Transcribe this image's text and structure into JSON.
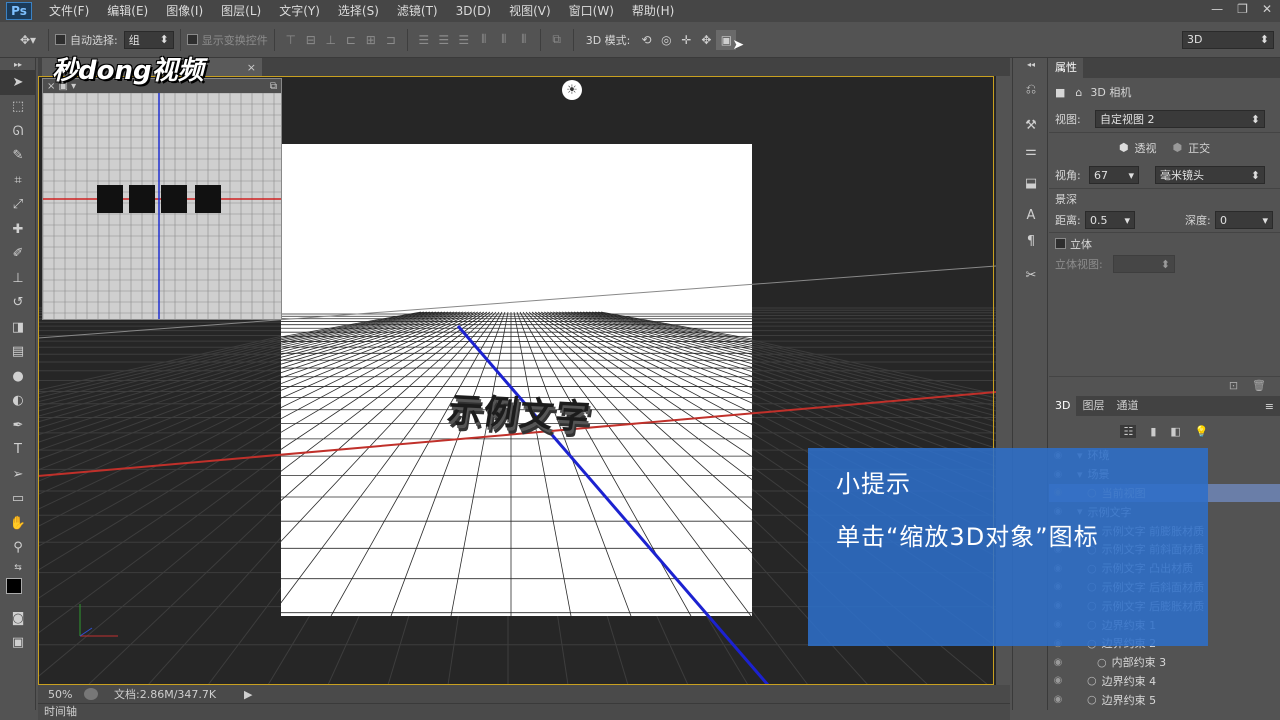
{
  "app": {
    "logo": "Ps"
  },
  "menu": [
    "文件(F)",
    "编辑(E)",
    "图像(I)",
    "图层(L)",
    "文字(Y)",
    "选择(S)",
    "滤镜(T)",
    "3D(D)",
    "视图(V)",
    "窗口(W)",
    "帮助(H)"
  ],
  "window_controls": [
    "—",
    "❐",
    "✕"
  ],
  "options": {
    "auto_select_label": "自动选择:",
    "auto_select_value": "组",
    "show_transform_label": "显示变换控件",
    "mode_label": "3D 模式:",
    "workspace_value": "3D"
  },
  "watermark": "秒dong视频",
  "canvas": {
    "text3d": "示例文字",
    "light_icon": "☀"
  },
  "status": {
    "zoom": "50%",
    "doc_info": "文档:2.86M/347.7K"
  },
  "timeline_label": "时间轴",
  "properties": {
    "tab": "属性",
    "title": "3D 相机",
    "view_label": "视图:",
    "view_value": "自定视图 2",
    "perspective_label": "透视",
    "ortho_label": "正交",
    "fov_label": "视角:",
    "fov_value": "67",
    "lens_value": "毫米镜头",
    "dof_label": "景深",
    "distance_label": "距离:",
    "distance_value": "0.5",
    "depth_label": "深度:",
    "depth_value": "0",
    "stereo_label": "立体",
    "stereo_view_label": "立体视图:"
  },
  "panel_tabs": [
    "3D",
    "图层",
    "通道"
  ],
  "layers": [
    {
      "label": "环境",
      "indent": 1
    },
    {
      "label": "场景",
      "indent": 1
    },
    {
      "label": "当前视图",
      "indent": 2
    },
    {
      "label": "示例文字",
      "indent": 1
    },
    {
      "label": "示例文字  前膨胀材质",
      "indent": 2
    },
    {
      "label": "示例文字  前斜面材质",
      "indent": 2
    },
    {
      "label": "示例文字  凸出材质",
      "indent": 2
    },
    {
      "label": "示例文字  后斜面材质",
      "indent": 2
    },
    {
      "label": "示例文字  后膨胀材质",
      "indent": 2
    },
    {
      "label": "边界约束 1",
      "indent": 2
    },
    {
      "label": "边界约束 2",
      "indent": 2
    },
    {
      "label": "内部约束 3",
      "indent": 3
    },
    {
      "label": "边界约束 4",
      "indent": 2
    },
    {
      "label": "边界约束 5",
      "indent": 2
    }
  ],
  "tip": {
    "title": "小提示",
    "body": "单击“缩放3D对象”图标"
  }
}
